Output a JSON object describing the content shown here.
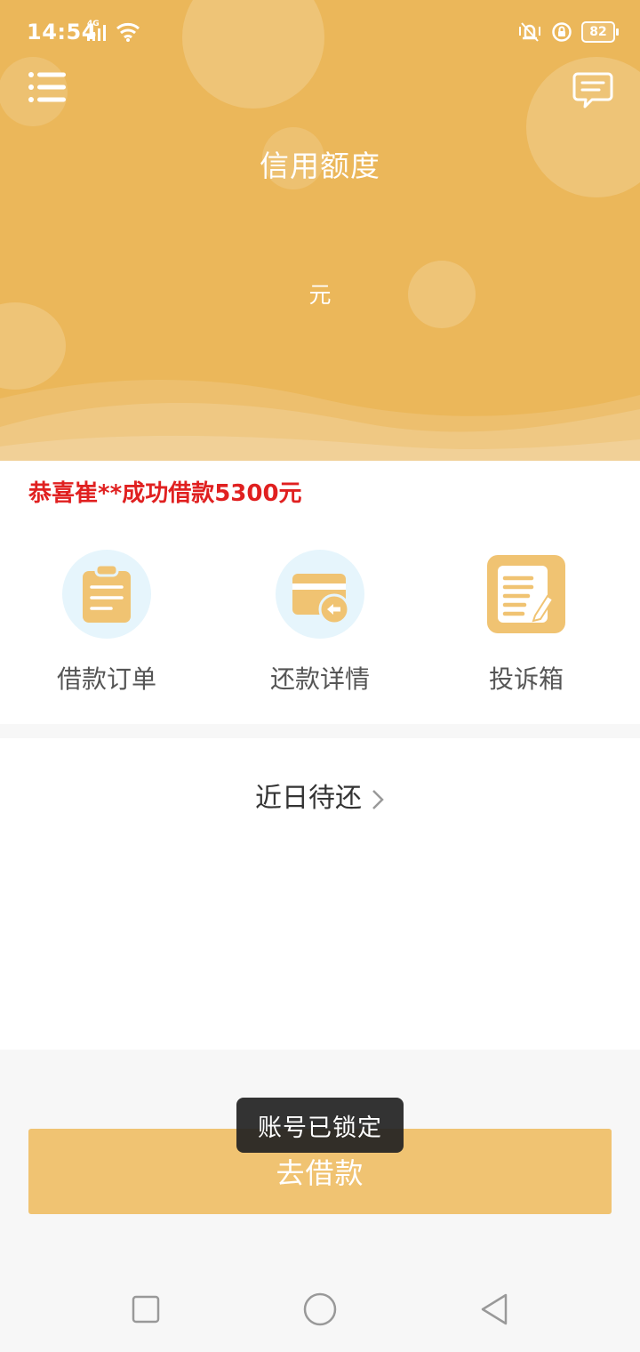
{
  "status_bar": {
    "time": "14:54",
    "network": "4G",
    "battery": "82"
  },
  "header": {
    "title": "信用额度",
    "unit": "元",
    "bg_color": "#ebb75a"
  },
  "notice": {
    "text": "恭喜崔**成功借款5300元",
    "color": "#e02020"
  },
  "shortcuts": [
    {
      "label": "借款订单",
      "icon": "clipboard-icon"
    },
    {
      "label": "还款详情",
      "icon": "card-return-icon"
    },
    {
      "label": "投诉箱",
      "icon": "notebook-pen-icon"
    }
  ],
  "recent": {
    "label": "近日待还"
  },
  "borrow_button": {
    "label": "去借款",
    "color": "#f0c372"
  },
  "toast": {
    "text": "账号已锁定"
  },
  "nav_bar": {
    "icons": [
      "square-recents-icon",
      "circle-home-icon",
      "triangle-back-icon"
    ]
  }
}
